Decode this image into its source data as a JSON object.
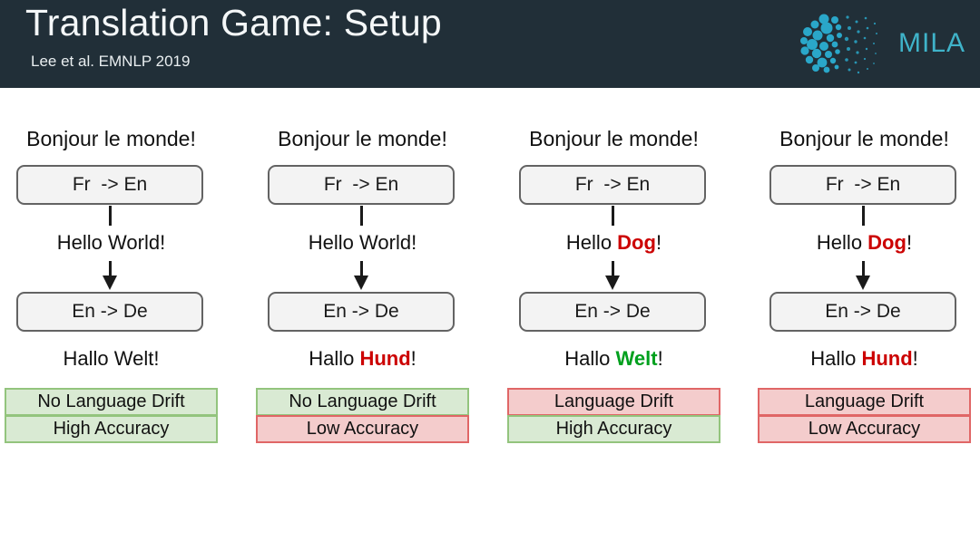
{
  "header": {
    "title": "Translation Game: Setup",
    "subtitle": "Lee et al. EMNLP 2019",
    "bar_color": "#212f38",
    "title_color": "#f4f7f8",
    "logo": {
      "name": "mila-logo",
      "text": "MILA",
      "text_color": "#3fb3c9",
      "mark_color": "#2aa7c9"
    }
  },
  "palette": {
    "green_fill": "#d9ead3",
    "green_border": "#93c47d",
    "red_fill": "#f4cccc",
    "red_border": "#e06666",
    "box_fill": "#f3f3f3",
    "box_border": "#636363",
    "highlight_red": "#cc0000",
    "highlight_green": "#00a01e"
  },
  "columns": [
    {
      "source_text": "Bonjour le monde!",
      "model_1": "Fr  -> En",
      "middle_prefix": "Hello ",
      "middle_highlight": "",
      "middle_highlight_color": "",
      "middle_suffix": "World!",
      "model_2": "En -> De",
      "output_prefix": "Hallo ",
      "output_highlight": "",
      "output_highlight_color": "",
      "output_suffix": "Welt!",
      "outcomes": [
        {
          "label": "No Language Drift",
          "status": "green"
        },
        {
          "label": "High Accuracy",
          "status": "green"
        }
      ]
    },
    {
      "source_text": "Bonjour le monde!",
      "model_1": "Fr  -> En",
      "middle_prefix": "Hello ",
      "middle_highlight": "",
      "middle_highlight_color": "",
      "middle_suffix": "World!",
      "model_2": "En -> De",
      "output_prefix": "Hallo ",
      "output_highlight": "Hund",
      "output_highlight_color": "red",
      "output_suffix": "!",
      "outcomes": [
        {
          "label": "No Language Drift",
          "status": "green"
        },
        {
          "label": "Low Accuracy",
          "status": "red"
        }
      ]
    },
    {
      "source_text": "Bonjour le monde!",
      "model_1": "Fr  -> En",
      "middle_prefix": "Hello ",
      "middle_highlight": "Dog",
      "middle_highlight_color": "red",
      "middle_suffix": "!",
      "model_2": "En -> De",
      "output_prefix": "Hallo ",
      "output_highlight": "Welt",
      "output_highlight_color": "green",
      "output_suffix": "!",
      "outcomes": [
        {
          "label": "Language Drift",
          "status": "red"
        },
        {
          "label": "High Accuracy",
          "status": "green"
        }
      ]
    },
    {
      "source_text": "Bonjour le monde!",
      "model_1": "Fr  -> En",
      "middle_prefix": "Hello ",
      "middle_highlight": "Dog",
      "middle_highlight_color": "red",
      "middle_suffix": "!",
      "model_2": "En -> De",
      "output_prefix": "Hallo ",
      "output_highlight": "Hund",
      "output_highlight_color": "red",
      "output_suffix": "!",
      "outcomes": [
        {
          "label": "Language Drift",
          "status": "red"
        },
        {
          "label": "Low Accuracy",
          "status": "red"
        }
      ]
    }
  ]
}
